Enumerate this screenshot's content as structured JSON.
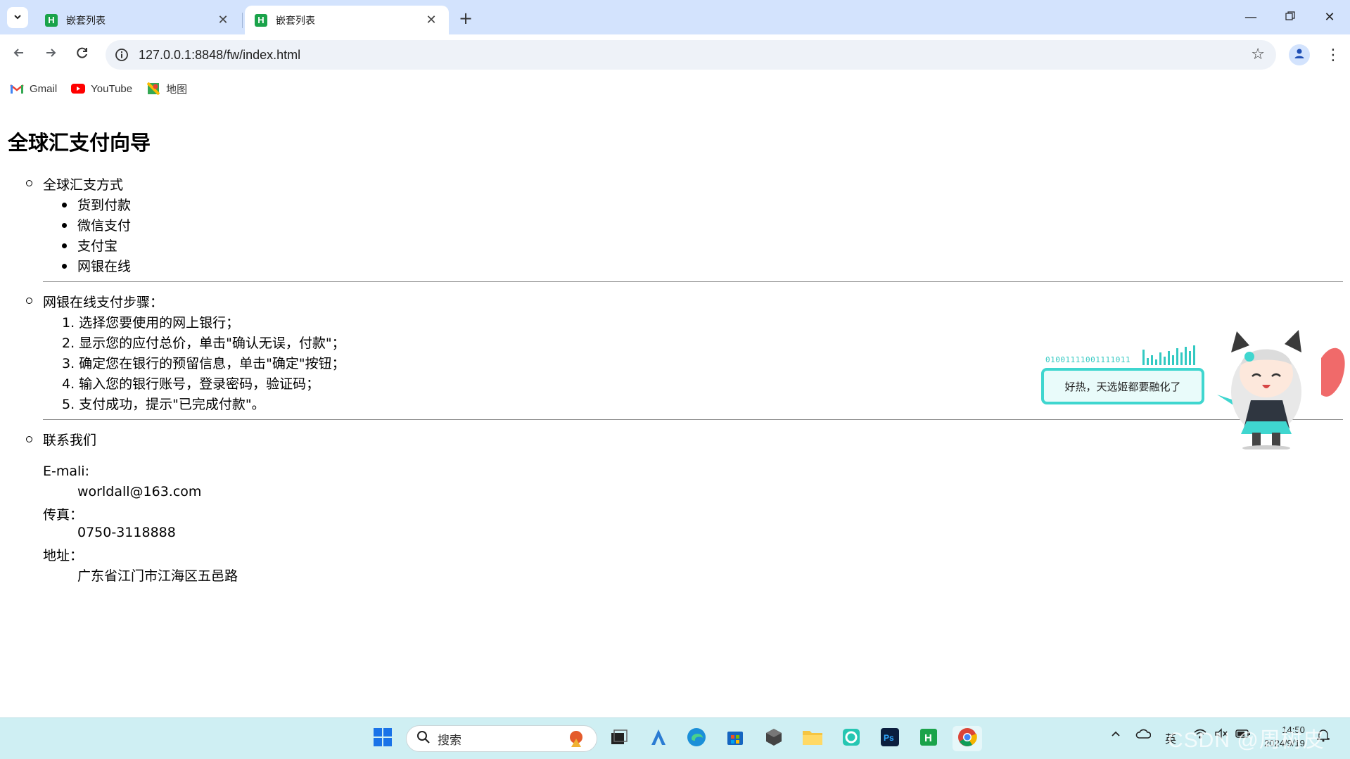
{
  "browser": {
    "tabs": [
      {
        "title": "嵌套列表",
        "favicon": "H",
        "active": false
      },
      {
        "title": "嵌套列表",
        "favicon": "H",
        "active": true
      }
    ],
    "url": "127.0.0.1:8848/fw/index.html",
    "bookmarks": [
      {
        "label": "Gmail",
        "icon": "gmail-icon"
      },
      {
        "label": "YouTube",
        "icon": "youtube-icon"
      },
      {
        "label": "地图",
        "icon": "maps-icon"
      }
    ]
  },
  "page": {
    "heading": "全球汇支付向导",
    "section1": {
      "title": "全球汇支方式",
      "items": [
        "货到付款",
        "微信支付",
        "支付宝",
        "网银在线"
      ]
    },
    "section2": {
      "title": "网银在线支付步骤：",
      "steps": [
        "1. 选择您要使用的网上银行；",
        "2. 显示您的应付总价，单击\"确认无误，付款\"；",
        "3. 确定您在银行的预留信息，单击\"确定\"按钮；",
        "4. 输入您的银行账号，登录密码，验证码；",
        "5. 支付成功，提示\"已完成付款\"。"
      ]
    },
    "section3": {
      "title": "联系我们",
      "contacts": [
        {
          "term": "E-mali:",
          "value": "worldall@163.com"
        },
        {
          "term": "传真：",
          "value": "0750-3118888"
        },
        {
          "term": "地址：",
          "value": "广东省江门市江海区五邑路"
        }
      ]
    }
  },
  "mascot": {
    "binary": "01001111001111011",
    "speech": "好热，天选姬都要融化了"
  },
  "taskbar": {
    "search_placeholder": "搜索",
    "ime": "英",
    "time": "14:50",
    "date": "2024/9/19",
    "watermark": "CSDN @周树皮"
  },
  "colors": {
    "tabstrip": "#d3e3fd",
    "taskbar": "#cfeff3",
    "accent_teal": "#3fd6cf",
    "favicon_green": "#1aa34a"
  }
}
